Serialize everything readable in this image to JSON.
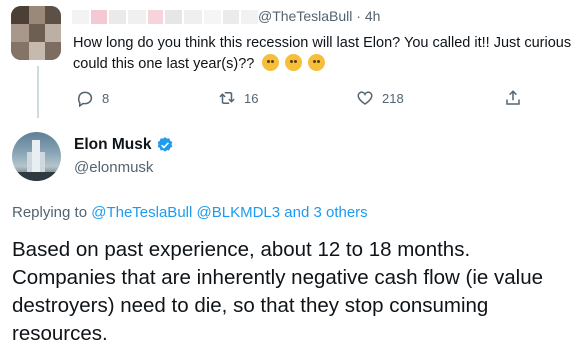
{
  "reply_tweet": {
    "handle": "@TheTeslaBull",
    "separator": "·",
    "time": "4h",
    "text": "How long do you think this recession will last Elon? You called it!! Just curious could this one last year(s)??",
    "emoji_icons": [
      "thinking-face-icon",
      "monocle-face-icon",
      "smirking-face-icon"
    ],
    "actions": {
      "reply_count": "8",
      "retweet_count": "16",
      "like_count": "218"
    }
  },
  "main_tweet": {
    "author_name": "Elon Musk",
    "author_handle": "@elonmusk",
    "replying_prefix": "Replying to",
    "replying_mentions": [
      "@TheTeslaBull",
      "@BLKMDL3"
    ],
    "replying_conjunction": "and",
    "replying_others": "3 others",
    "text": "Based on past experience, about 12 to 18 months. Companies that are inherently negative cash flow (ie value destroyers) need to die, so that they stop consuming resources."
  },
  "colors": {
    "text_primary": "#0f1419",
    "text_secondary": "#536471",
    "link": "#1d9bf0",
    "verified": "#1d9bf0",
    "divider": "#cfd9de"
  }
}
